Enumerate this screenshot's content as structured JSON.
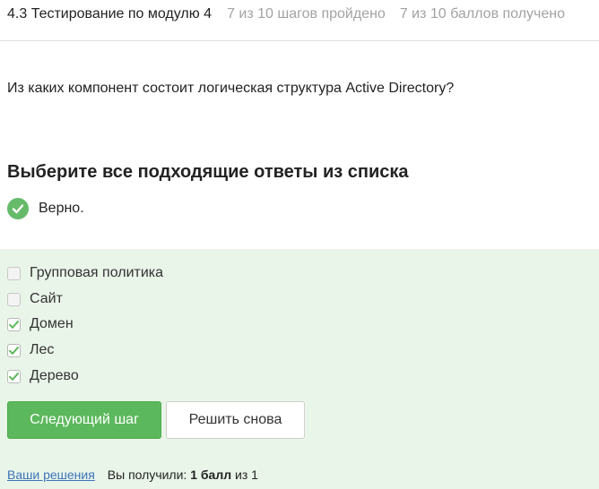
{
  "header": {
    "title": "4.3 Тестирование по модулю 4",
    "steps": "7 из 10 шагов пройдено",
    "points": "7 из 10 баллов  получено"
  },
  "question": "Из каких компонент состоит логическая структура Active Directory?",
  "prompt": "Выберите все подходящие ответы из списка",
  "verdict": {
    "text": "Верно.",
    "color": "#66bb6a"
  },
  "options": [
    {
      "label": "Групповая политика",
      "checked": false
    },
    {
      "label": "Сайт",
      "checked": false
    },
    {
      "label": "Домен",
      "checked": true
    },
    {
      "label": "Лес",
      "checked": true
    },
    {
      "label": "Дерево",
      "checked": true
    }
  ],
  "buttons": {
    "next": "Следующий шаг",
    "retry": "Решить снова"
  },
  "footer": {
    "solutions_link": "Ваши решения",
    "score_prefix": "Вы получили:",
    "score_value": "1 балл",
    "score_suffix": "из 1"
  },
  "colors": {
    "accent_green": "#5cb85c",
    "panel_bg": "#e9f5e9",
    "link": "#3b73b9"
  }
}
